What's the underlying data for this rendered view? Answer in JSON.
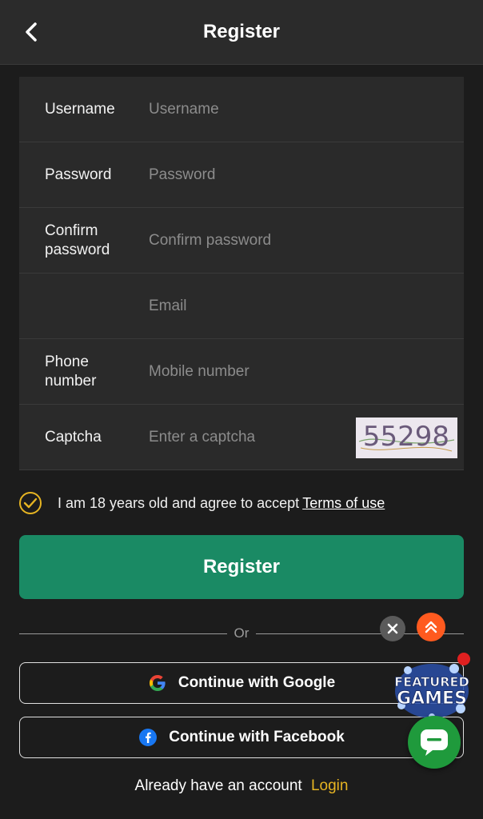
{
  "header": {
    "title": "Register",
    "back_icon": "chevron-left-icon"
  },
  "form": {
    "rows": [
      {
        "label": "Username",
        "placeholder": "Username"
      },
      {
        "label": "Password",
        "placeholder": "Password"
      },
      {
        "label": "Confirm password",
        "placeholder": "Confirm password"
      },
      {
        "label": "",
        "placeholder": "Email"
      },
      {
        "label": "Phone number",
        "placeholder": "Mobile number"
      },
      {
        "label": "Captcha",
        "placeholder": "Enter a captcha"
      }
    ],
    "captcha_code": "55298"
  },
  "agree": {
    "text": "I am 18 years old and agree to accept",
    "terms_link": "Terms of use",
    "checked": true
  },
  "register_button": "Register",
  "divider_text": "Or",
  "social": {
    "google_label": "Continue with Google",
    "facebook_label": "Continue with Facebook"
  },
  "footer": {
    "text": "Already have an account",
    "login_link": "Login"
  },
  "floating": {
    "featured_line1": "FEATURED",
    "featured_line2": "GAMES"
  },
  "colors": {
    "background": "#1c1c1c",
    "header": "#2b2b2b",
    "form_bg": "#2a2a2a",
    "accent_green": "#1a8a64",
    "accent_gold": "#e6b422",
    "chat_green": "#1f9a3c",
    "scroll_orange": "#ff5a1f"
  }
}
